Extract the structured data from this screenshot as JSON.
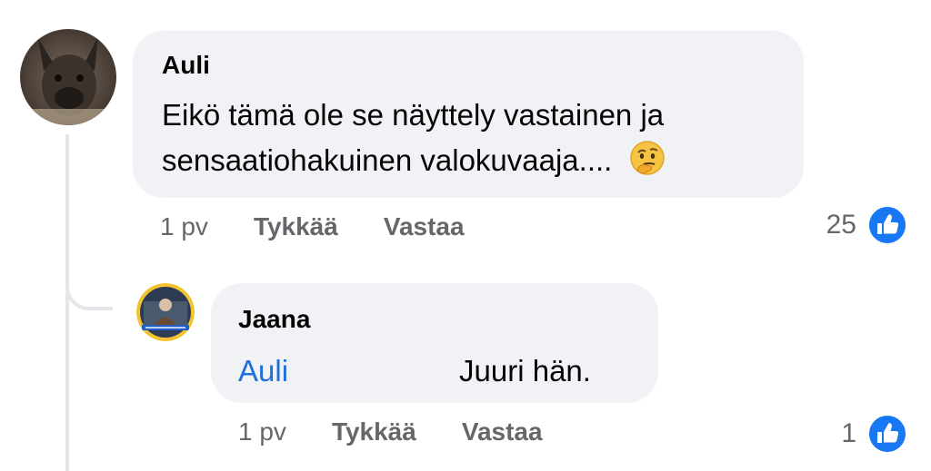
{
  "comments": [
    {
      "author": "Auli",
      "text_line1": "Eikö tämä ole se näyttely vastainen ja",
      "text_line2": "sensaatiohakuinen valokuvaaja....",
      "emoji": "thinking-face-emoji",
      "time": "1 pv",
      "like_label": "Tykkää",
      "reply_label": "Vastaa",
      "reaction_count": "25",
      "reaction_icon": "like-icon"
    },
    {
      "author": "Jaana",
      "mention": "Auli",
      "text": "Juuri hän.",
      "time": "1 pv",
      "like_label": "Tykkää",
      "reply_label": "Vastaa",
      "reaction_count": "1",
      "reaction_icon": "like-icon"
    }
  ],
  "colors": {
    "bubble": "#f0f2f5",
    "mention": "#216fdb",
    "muted": "#65676b",
    "like_blue": "#1877f2"
  }
}
